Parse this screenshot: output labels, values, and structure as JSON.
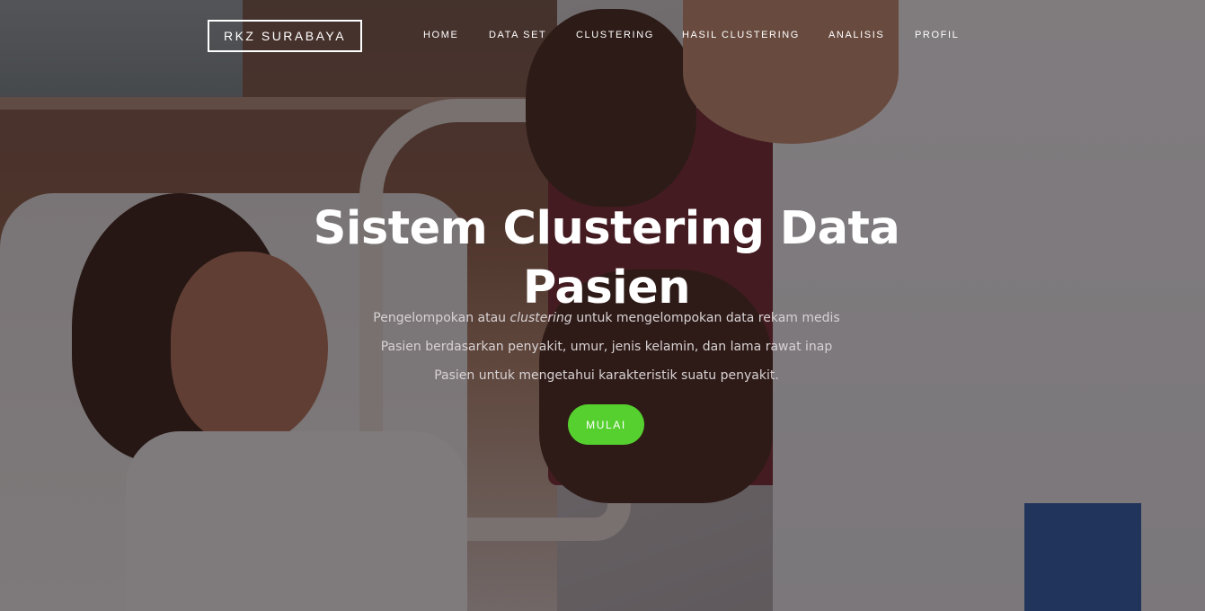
{
  "brand": "RKZ SURABAYA",
  "nav": {
    "items": [
      "HOME",
      "DATA SET",
      "CLUSTERING",
      "HASIL CLUSTERING",
      "ANALISIS",
      "PROFIL"
    ]
  },
  "hero": {
    "title_line1": "Sistem Clustering Data",
    "title_line2": "Pasien",
    "desc_line1_before": "Pengelompokan atau ",
    "desc_line1_em": "clustering",
    "desc_line1_after": " untuk mengelompokan data rekam medis",
    "desc_line2": "Pasien berdasarkan penyakit, umur, jenis kelamin, dan lama rawat inap",
    "desc_line3": "Pasien untuk mengetahui karakteristik suatu penyakit.",
    "cta_label": "MULAI"
  },
  "colors": {
    "accent": "#55d02f",
    "text": "#ffffff"
  }
}
